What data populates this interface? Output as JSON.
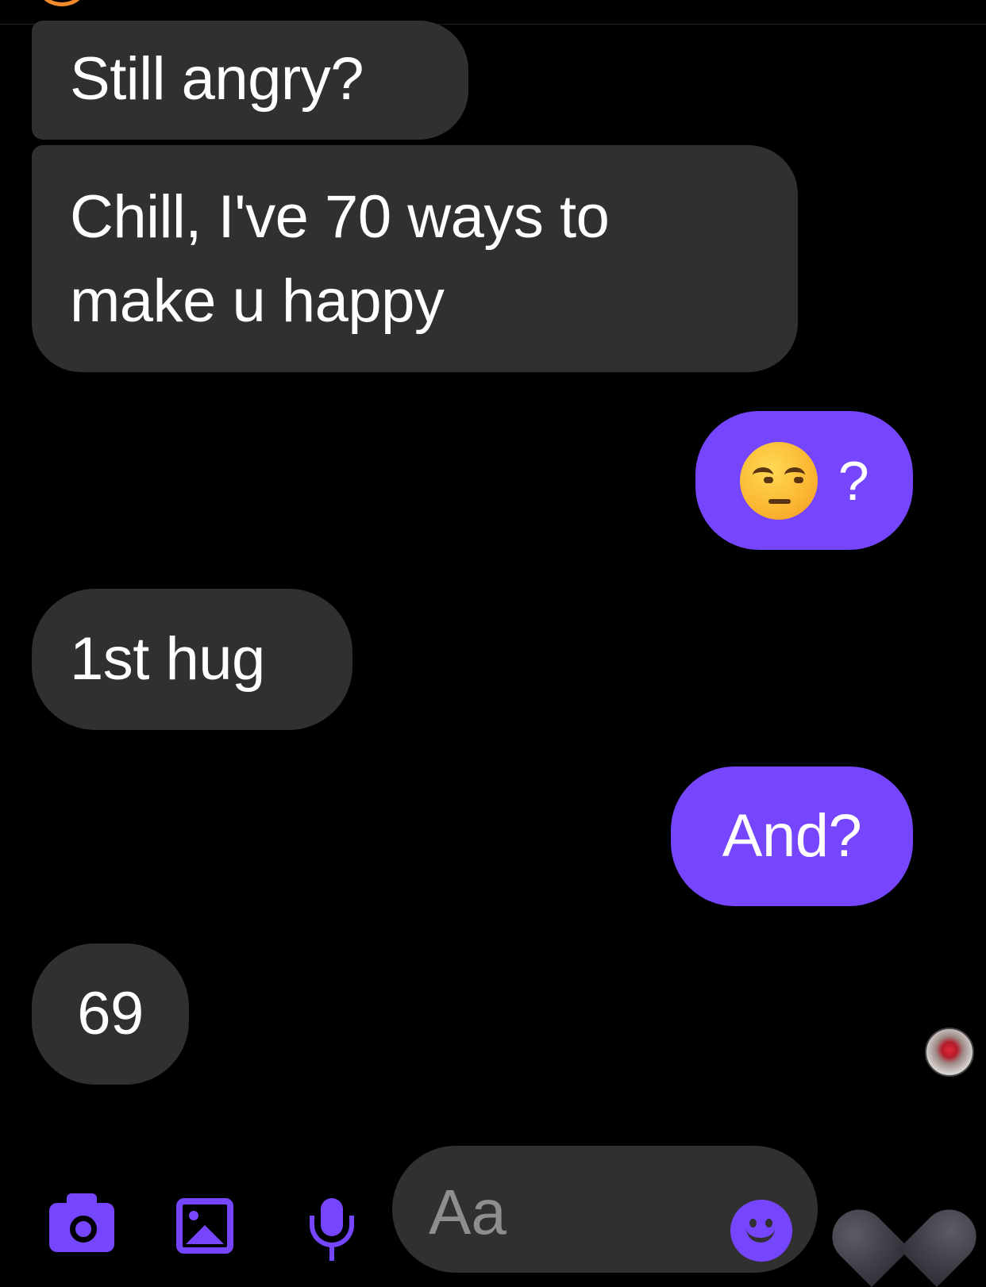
{
  "conversation": {
    "messages": [
      {
        "direction": "incoming",
        "text": "Still angry?"
      },
      {
        "direction": "incoming",
        "text": "Chill, I've 70 ways to make u happy"
      },
      {
        "direction": "outgoing",
        "emoji": "unamused-face-emoji",
        "text": "?"
      },
      {
        "direction": "incoming",
        "text": "1st hug"
      },
      {
        "direction": "outgoing",
        "text": "And?"
      },
      {
        "direction": "incoming",
        "text": "69"
      }
    ]
  },
  "composer": {
    "placeholder": "Aa",
    "icons": [
      "camera-icon",
      "gallery-icon",
      "mic-icon",
      "smile-icon",
      "heart-icon"
    ]
  },
  "colors": {
    "background": "#000000",
    "incoming_bubble": "#303030",
    "outgoing_bubble": "#7646ff",
    "accent": "#7646ff",
    "placeholder_text": "#8e8e8e"
  }
}
